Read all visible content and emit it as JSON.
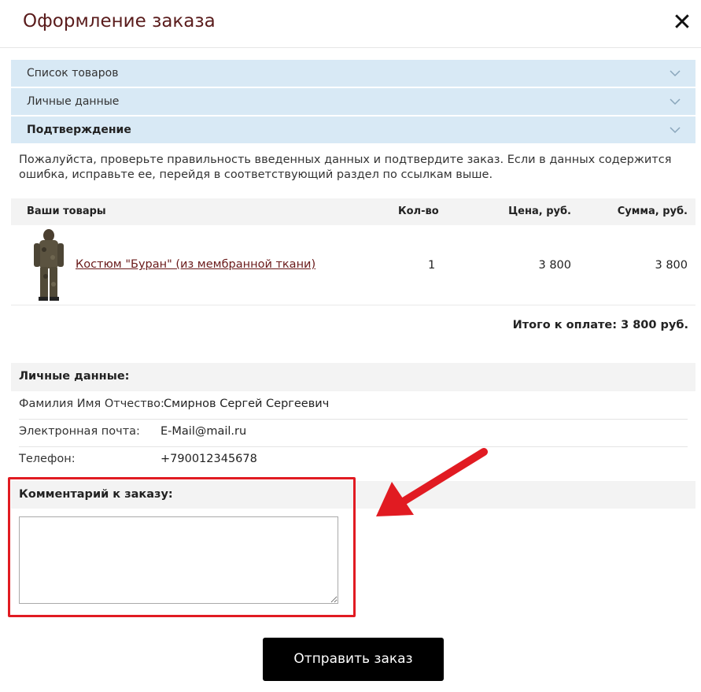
{
  "header": {
    "title": "Оформление заказа",
    "close_icon": "close-icon"
  },
  "accordion": [
    {
      "label": "Список товаров"
    },
    {
      "label": "Личные данные"
    },
    {
      "label": "Подтверждение"
    }
  ],
  "note": "Пожалуйста, проверьте правильность введенных данных и подтвердите заказ. Если в данных содержится ошибка, исправьте ее, перейдя в соответствующий раздел по ссылкам выше.",
  "table": {
    "headers": {
      "product": "Ваши товары",
      "qty": "Кол-во",
      "price": "Цена, руб.",
      "sum": "Сумма, руб."
    },
    "items": [
      {
        "name": "Костюм \"Буран\" (из мембранной ткани)",
        "qty": "1",
        "price": "3 800",
        "sum": "3 800",
        "image_icon": "suit-image"
      }
    ],
    "total": "Итого к оплате: 3 800 руб."
  },
  "personal": {
    "heading": "Личные данные:",
    "rows": [
      {
        "label": "Фамилия Имя Отчество:",
        "value": "Смирнов Сергей Сергеевич"
      },
      {
        "label": "Электронная почта:",
        "value": "E-Mail@mail.ru"
      },
      {
        "label": "Телефон:",
        "value": "+790012345678"
      }
    ]
  },
  "comment": {
    "heading": "Комментарий к заказу:",
    "value": ""
  },
  "submit_label": "Отправить заказ",
  "colors": {
    "accent_blue": "#d8e9f5",
    "highlight_red": "#e11b22",
    "title": "#5a1c1c",
    "button": "#000000"
  }
}
